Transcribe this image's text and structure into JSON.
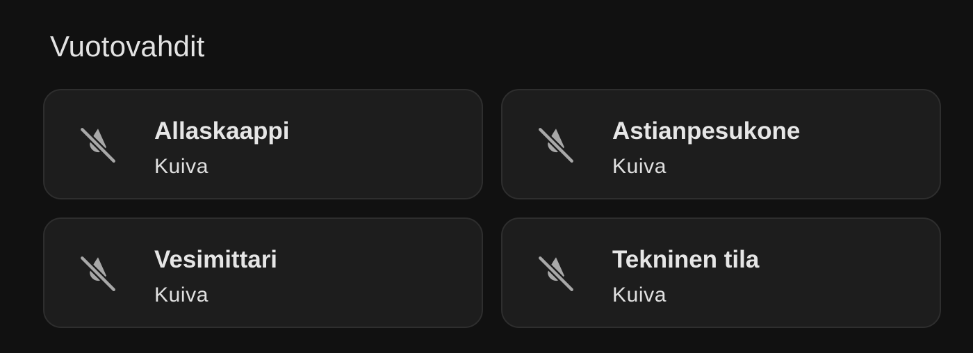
{
  "section": {
    "title": "Vuotovahdit"
  },
  "tiles": [
    {
      "name": "Allaskaappi",
      "state": "Kuiva",
      "icon": "water-off-icon"
    },
    {
      "name": "Astianpesukone",
      "state": "Kuiva",
      "icon": "water-off-icon"
    },
    {
      "name": "Vesimittari",
      "state": "Kuiva",
      "icon": "water-off-icon"
    },
    {
      "name": "Tekninen tila",
      "state": "Kuiva",
      "icon": "water-off-icon"
    }
  ],
  "colors": {
    "background": "#111111",
    "tile_background": "#1d1d1d",
    "tile_border": "#2e2e2e",
    "icon": "#a8a8a8",
    "text": "#e6e6e6"
  }
}
